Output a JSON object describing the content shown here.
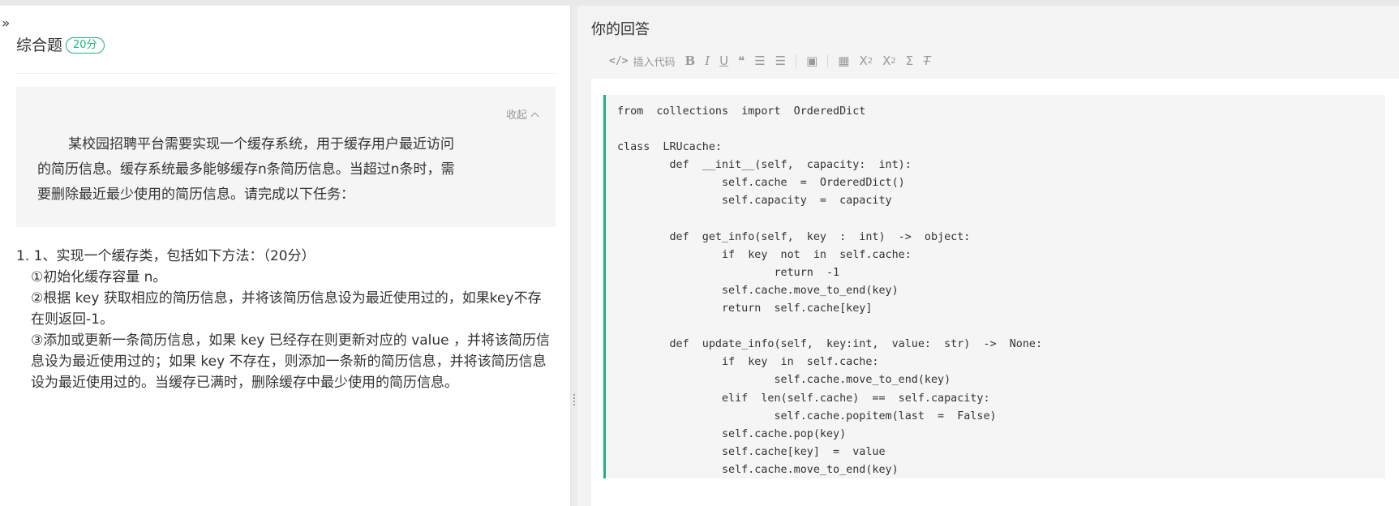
{
  "left": {
    "toggle_label": "»",
    "question_title": "综合题",
    "score_badge": "20分",
    "fold_label": "收起",
    "stem": "某校园招聘平台需要实现一个缓存系统，用于缓存用户最近访问的简历信息。缓存系统最多能够缓存n条简历信息。当超过n条时，需要删除最近最少使用的简历信息。请完成以下任务：",
    "tasks": [
      "1. 1、实现一个缓存类，包括如下方法：（20分）",
      "①初始化缓存容量 n。",
      "②根据 key 获取相应的简历信息，并将该简历信息设为最近使用过的，如果key不存在则返回-1。",
      "③添加或更新一条简历信息，如果 key 已经存在则更新对应的 value ，并将该简历信息设为最近使用过的；如果 key 不存在，则添加一条新的简历信息，并将该简历信息设为最近使用过的。当缓存已满时，删除缓存中最少使用的简历信息。"
    ]
  },
  "right": {
    "answer_title": "你的回答",
    "toolbar": {
      "insert_code": "插入代码",
      "icons": [
        "code-icon",
        "bold-icon",
        "italic-icon",
        "underline-icon",
        "quote-icon",
        "ordered-list-icon",
        "unordered-list-icon",
        "image-icon",
        "table-icon",
        "subscript-icon",
        "superscript-icon",
        "formula-icon",
        "clear-format-icon"
      ]
    },
    "code": "from  collections  import  OrderedDict\n\nclass  LRUcache:\n        def  __init__(self,  capacity:  int):\n                self.cache  =  OrderedDict()\n                self.capacity  =  capacity\n\n        def  get_info(self,  key  :  int)  ->  object:\n                if  key  not  in  self.cache:\n                        return  -1\n                self.cache.move_to_end(key)\n                return  self.cache[key]\n\n        def  update_info(self,  key:int,  value:  str)  ->  None:\n                if  key  in  self.cache:\n                        self.cache.move_to_end(key)\n                elif  len(self.cache)  ==  self.capacity:\n                        self.cache.popitem(last  =  False)\n                self.cache.pop(key)\n                self.cache[key]  =  value\n                self.cache.move_to_end(key)"
  },
  "colors": {
    "accent": "#1fb37a",
    "toolbar_icon": "#999999",
    "background": "#f3f3f3"
  }
}
